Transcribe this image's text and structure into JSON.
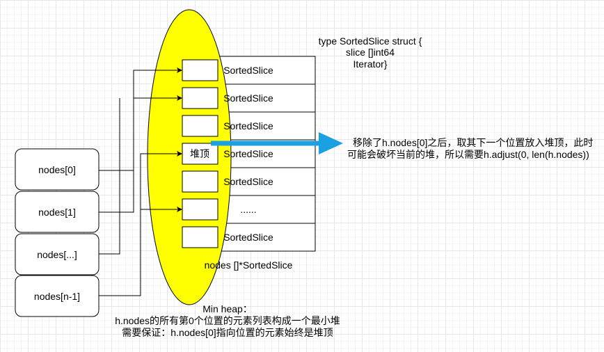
{
  "struct_definition": {
    "line1": "type SortedSlice struct {",
    "line2": "slice []int64",
    "line3": "Iterator}"
  },
  "slice_rows": [
    {
      "label": "SortedSlice"
    },
    {
      "label": "SortedSlice"
    },
    {
      "label": "SortedSlice"
    },
    {
      "label": "SortedSlice"
    },
    {
      "label": "SortedSlice"
    },
    {
      "label": "......"
    },
    {
      "label": "SortedSlice"
    }
  ],
  "heap_slots": [
    {
      "label": ""
    },
    {
      "label": ""
    },
    {
      "label": ""
    },
    {
      "label": "堆顶"
    },
    {
      "label": ""
    },
    {
      "label": ""
    },
    {
      "label": ""
    }
  ],
  "node_boxes": [
    {
      "label": "nodes[0]"
    },
    {
      "label": "nodes[1]"
    },
    {
      "label": "nodes[...]"
    },
    {
      "label": "nodes[n-1]"
    }
  ],
  "slice_caption": "nodes []*SortedSlice",
  "note": {
    "line1": "移除了h.nodes[0]之后，取其下一个位置放入堆顶，此时",
    "line2": "可能会破坏当前的堆，所以需要h.adjust(0, len(h.nodes))"
  },
  "heap_caption": {
    "line1": "Min heap：",
    "line2": "h.nodes的所有第0个位置的元素列表构成一个最小堆",
    "line3": "需要保证：h.nodes[0]指向位置的元素始终是堆顶"
  },
  "colors": {
    "ellipse_fill": "#ffff00",
    "arrow_blue": "#1ba1e2",
    "stroke": "#000000"
  }
}
